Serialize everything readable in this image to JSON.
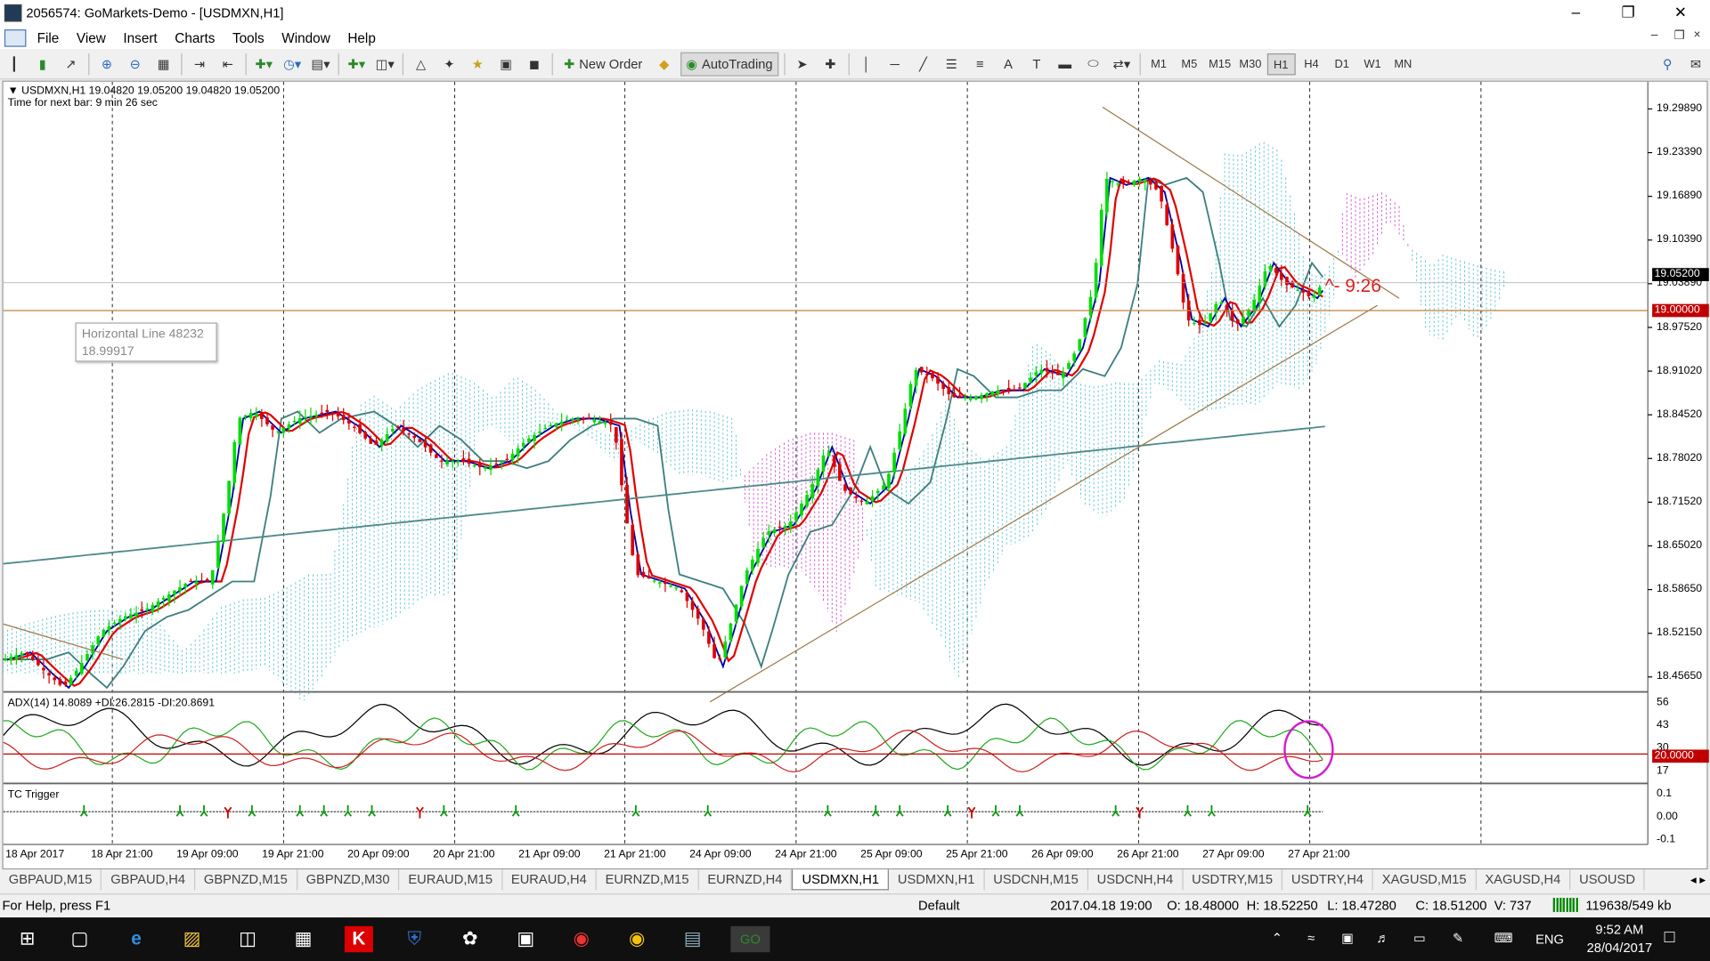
{
  "window": {
    "title": "2056574: GoMarkets-Demo - [USDMXN,H1]",
    "controls": [
      "–",
      "❐",
      "✕"
    ]
  },
  "menu": {
    "items": [
      "File",
      "View",
      "Insert",
      "Charts",
      "Tools",
      "Window",
      "Help"
    ],
    "mdi_controls": [
      "–",
      "ᴘ",
      "×"
    ]
  },
  "toolbar": {
    "new_order_label": "New Order",
    "autotrading_label": "AutoTrading",
    "timeframes": [
      "M1",
      "M5",
      "M15",
      "M30",
      "H1",
      "H4",
      "D1",
      "W1",
      "MN"
    ],
    "active_timeframe": "H1"
  },
  "chart": {
    "header_line1": "USDMXN,H1  19.04820 19.05200 19.04820 19.05200",
    "header_line2": "Time for next bar: 9 min 26 sec",
    "countdown_label": "^- 9:26",
    "price_labels": [
      "19.29890",
      "19.23390",
      "19.16890",
      "19.10390",
      "19.03890",
      "18.97520",
      "18.91020",
      "18.84520",
      "18.78020",
      "18.71520",
      "18.65020",
      "18.58650",
      "18.52150",
      "18.45650"
    ],
    "current_price_tag": "19.05200",
    "hline_tag": "19.00000",
    "tooltip_line1": "Horizontal Line 48232",
    "tooltip_line2": "18.99917",
    "adx_header": "ADX(14) 14.8089 +DI:26.2815 -DI:20.8691",
    "adx_scale": [
      "56",
      "43",
      "30",
      "17"
    ],
    "adx_level_tag": "20.0000",
    "tc_header": "TC Trigger",
    "tc_scale": [
      "0.1",
      "0.00",
      "-0.1"
    ],
    "time_labels": [
      "18 Apr 2017",
      "18 Apr 21:00",
      "19 Apr 09:00",
      "19 Apr 21:00",
      "20 Apr 09:00",
      "20 Apr 21:00",
      "21 Apr 09:00",
      "21 Apr 21:00",
      "24 Apr 09:00",
      "24 Apr 21:00",
      "25 Apr 09:00",
      "25 Apr 21:00",
      "26 Apr 09:00",
      "26 Apr 21:00",
      "27 Apr 09:00",
      "27 Apr 21:00"
    ],
    "colors": {
      "bull": "#00dd00",
      "bear": "#dd0000",
      "fast_ma": "#0000aa",
      "mid_ma": "#e00000",
      "slow_ma": "#3f7f7f",
      "cloud_up": "#6cc8d8",
      "cloud_down": "#d060d0",
      "trendline": "#9c7a4a",
      "hline": "#c08040",
      "plus_di": "#22aa22",
      "minus_di": "#cc2222",
      "adx_main": "#000000"
    }
  },
  "tabs": [
    "GBPAUD,M15",
    "GBPAUD,H4",
    "GBPNZD,M15",
    "GBPNZD,M30",
    "EURAUD,M15",
    "EURAUD,H4",
    "EURNZD,M15",
    "EURNZD,H4",
    "USDMXN,H1",
    "USDMXN,H1",
    "USDCNH,M15",
    "USDCNH,H4",
    "USDTRY,M15",
    "USDTRY,H4",
    "XAGUSD,M15",
    "XAGUSD,H4",
    "USOUSD"
  ],
  "active_tab": "USDMXN,H1",
  "status": {
    "help": "For Help, press F1",
    "profile": "Default",
    "datetime": "2017.04.18 19:00",
    "open": "O: 18.48000",
    "high": "H: 18.52250",
    "low": "L: 18.47280",
    "close": "C: 18.51200",
    "volume": "V: 737",
    "traffic": "119638/549 kb"
  },
  "taskbar": {
    "lang": "ENG",
    "time": "9:52 AM",
    "date": "28/04/2017"
  }
}
